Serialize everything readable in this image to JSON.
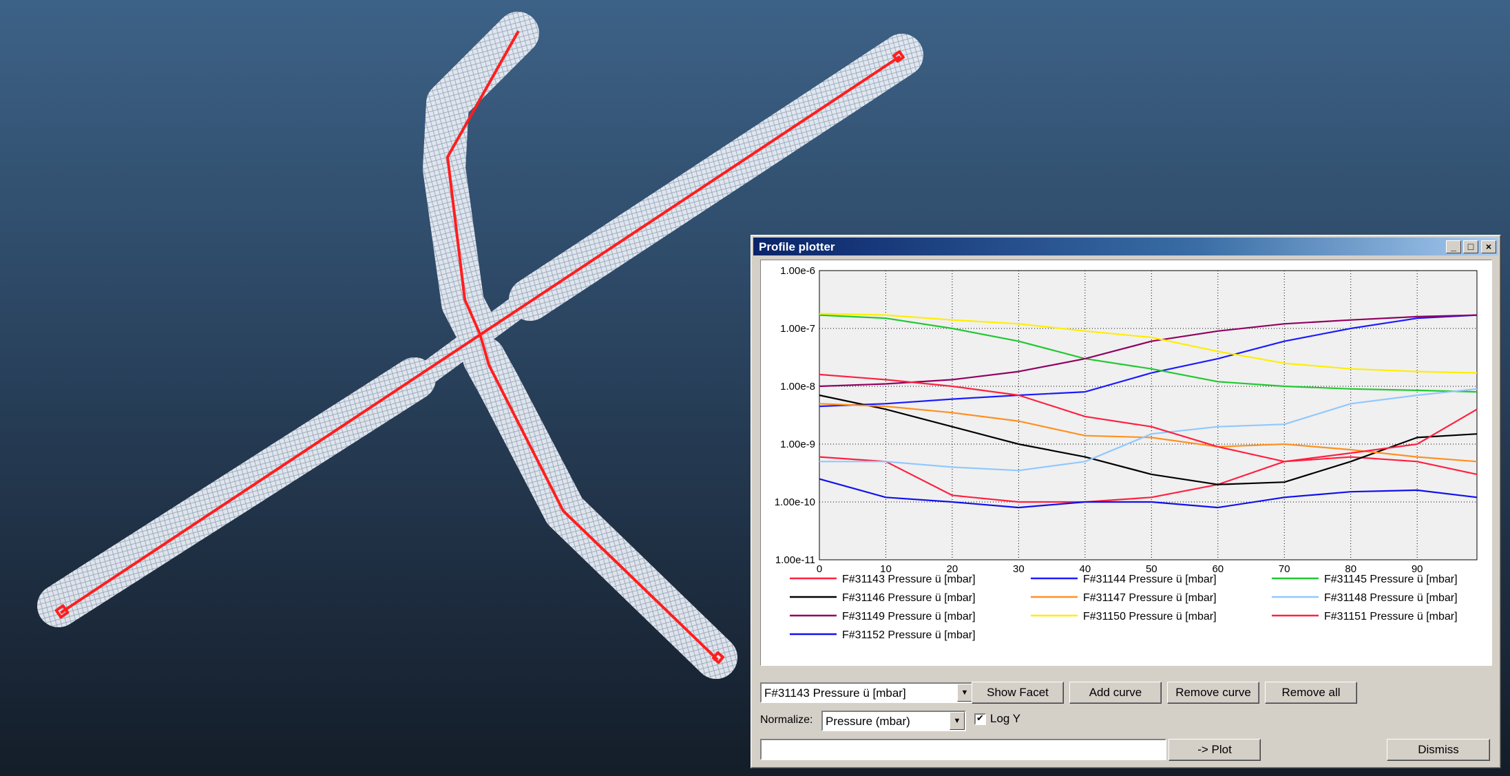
{
  "colors": {
    "tube": "#eef2f8",
    "path": "#ff1e1e"
  },
  "window": {
    "title": "Profile plotter",
    "minimize_glyph": "_",
    "maximize_glyph": "□",
    "close_glyph": "×"
  },
  "chart_data": {
    "type": "line",
    "x": [
      0,
      10,
      20,
      30,
      40,
      50,
      60,
      70,
      80,
      90,
      99
    ],
    "xlim": [
      0,
      99
    ],
    "x_ticks": [
      "0",
      "10",
      "20",
      "30",
      "40",
      "50",
      "60",
      "70",
      "80",
      "90"
    ],
    "y_scale": "log",
    "ylim": [
      1e-11,
      1e-06
    ],
    "y_ticks": [
      "1.00e-6",
      "1.00e-7",
      "1.00e-8",
      "1.00e-9",
      "1.00e-10",
      "1.00e-11"
    ],
    "grid": true,
    "legend_position": "bottom",
    "series": [
      {
        "name": "F#31143 Pressure ü [mbar]",
        "color": "#ff2040",
        "values": [
          6e-10,
          5e-10,
          1.3e-10,
          1e-10,
          1e-10,
          1.2e-10,
          2e-10,
          5e-10,
          6e-10,
          5e-10,
          3e-10
        ]
      },
      {
        "name": "F#31144 Pressure ü [mbar]",
        "color": "#1a1aff",
        "values": [
          4.5e-09,
          5e-09,
          6e-09,
          7e-09,
          8e-09,
          1.7e-08,
          3e-08,
          6e-08,
          1e-07,
          1.5e-07,
          1.7e-07
        ]
      },
      {
        "name": "F#31145 Pressure ü [mbar]",
        "color": "#20c830",
        "values": [
          1.7e-07,
          1.5e-07,
          1e-07,
          6e-08,
          3e-08,
          2e-08,
          1.2e-08,
          1e-08,
          9e-09,
          8.5e-09,
          8e-09
        ]
      },
      {
        "name": "F#31146 Pressure ü [mbar]",
        "color": "#000000",
        "values": [
          7e-09,
          4e-09,
          2e-09,
          1e-09,
          6e-10,
          3e-10,
          2e-10,
          2.2e-10,
          5e-10,
          1.3e-09,
          1.5e-09
        ]
      },
      {
        "name": "F#31147 Pressure ü [mbar]",
        "color": "#ff9020",
        "values": [
          5e-09,
          4.5e-09,
          3.5e-09,
          2.5e-09,
          1.4e-09,
          1.3e-09,
          9e-10,
          1e-09,
          8e-10,
          6e-10,
          5e-10
        ]
      },
      {
        "name": "F#31148 Pressure ü [mbar]",
        "color": "#90c8ff",
        "values": [
          5e-10,
          5e-10,
          4e-10,
          3.5e-10,
          5e-10,
          1.5e-09,
          2e-09,
          2.2e-09,
          5e-09,
          7e-09,
          9e-09
        ]
      },
      {
        "name": "F#31149 Pressure ü [mbar]",
        "color": "#900060",
        "values": [
          1e-08,
          1.1e-08,
          1.3e-08,
          1.8e-08,
          3e-08,
          6e-08,
          9e-08,
          1.2e-07,
          1.4e-07,
          1.6e-07,
          1.7e-07
        ]
      },
      {
        "name": "F#31150 Pressure ü [mbar]",
        "color": "#ffee00",
        "values": [
          1.8e-07,
          1.7e-07,
          1.4e-07,
          1.2e-07,
          9e-08,
          7e-08,
          4e-08,
          2.5e-08,
          2e-08,
          1.8e-08,
          1.7e-08
        ]
      },
      {
        "name": "F#31151 Pressure ü [mbar]",
        "color": "#ff2040",
        "values": [
          1.6e-08,
          1.3e-08,
          1e-08,
          7e-09,
          3e-09,
          2e-09,
          9e-10,
          5e-10,
          7e-10,
          1e-09,
          4e-09
        ]
      },
      {
        "name": "F#31152 Pressure ü [mbar]",
        "color": "#1010ee",
        "values": [
          2.5e-10,
          1.2e-10,
          1e-10,
          8e-11,
          1e-10,
          1e-10,
          8e-11,
          1.2e-10,
          1.5e-10,
          1.6e-10,
          1.2e-10
        ]
      }
    ]
  },
  "controls": {
    "curve_select_value": "F#31143 Pressure ü [mbar]",
    "show_facet_label": "Show Facet",
    "add_curve_label": "Add curve",
    "remove_curve_label": "Remove curve",
    "remove_all_label": "Remove all",
    "normalize_label": "Normalize:",
    "normalize_value": "Pressure (mbar)",
    "log_y_label": "Log Y",
    "log_y_checked": true,
    "formula_value": "",
    "plot_label": "-> Plot",
    "dismiss_label": "Dismiss",
    "dropdown_glyph": "▼",
    "check_glyph": "✔"
  }
}
